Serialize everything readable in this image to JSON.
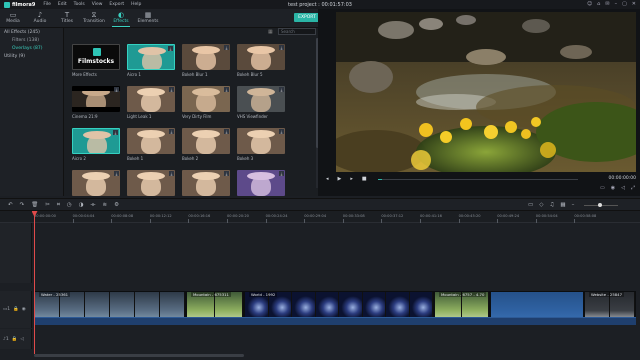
{
  "app": {
    "name": "filmora9",
    "menus": [
      "File",
      "Edit",
      "Tools",
      "View",
      "Export",
      "Help"
    ],
    "project_title": "test project : 00:01:57:03"
  },
  "toolbar": {
    "tabs": [
      {
        "label": "Media",
        "icon": "folder-icon"
      },
      {
        "label": "Audio",
        "icon": "music-note-icon"
      },
      {
        "label": "Titles",
        "icon": "text-t-icon"
      },
      {
        "label": "Transition",
        "icon": "transition-icon"
      },
      {
        "label": "Effects",
        "icon": "effects-icon",
        "active": true
      },
      {
        "label": "Elements",
        "icon": "elements-icon"
      }
    ],
    "export_label": "EXPORT"
  },
  "categories": [
    {
      "label": "All Effects (245)",
      "level": 0
    },
    {
      "label": "Filters (138)",
      "level": 1
    },
    {
      "label": "Overlays (87)",
      "level": 1,
      "selected": true
    },
    {
      "label": "Utility (9)",
      "level": 0
    }
  ],
  "effects_panel": {
    "search_placeholder": "Search",
    "items": [
      {
        "label": "More Effects",
        "style": "filmstocks",
        "badge": "Filmstocks"
      },
      {
        "label": "Aicro 1",
        "style": "teal"
      },
      {
        "label": "Bokeh Blur 1",
        "style": "warm"
      },
      {
        "label": "Bokeh Blur 5",
        "style": "warm"
      },
      {
        "label": "Cinema 21:9",
        "style": "cinema"
      },
      {
        "label": "Light Leak 1",
        "style": "light"
      },
      {
        "label": "Very Dirty Film",
        "style": "dirty"
      },
      {
        "label": "VHS Viewfinder",
        "style": "vhs"
      },
      {
        "label": "Aicro 2",
        "style": "teal"
      },
      {
        "label": "Bokeh 1",
        "style": "light"
      },
      {
        "label": "Bokeh 2",
        "style": "light"
      },
      {
        "label": "Bokeh 3",
        "style": "light"
      },
      {
        "label": "",
        "style": "light"
      },
      {
        "label": "",
        "style": "light"
      },
      {
        "label": "",
        "style": "light"
      },
      {
        "label": "",
        "style": "purple"
      }
    ]
  },
  "preview": {
    "timecode": "00:00:00:00",
    "progress": 0.02
  },
  "timeline": {
    "ruler": [
      "00:00:00:00",
      "00:00:04:04",
      "00:00:08:08",
      "00:00:12:12",
      "00:00:16:16",
      "00:00:20:20",
      "00:00:24:24",
      "00:00:29:04",
      "00:00:33:08",
      "00:00:37:12",
      "00:00:41:16",
      "00:00:45:20",
      "00:00:49:24",
      "00:00:54:04",
      "00:00:58:08"
    ],
    "clips": [
      {
        "name": "Water - 25361",
        "style": "water"
      },
      {
        "name": "Mountain - 675311",
        "style": "mountain"
      },
      {
        "name": "World - 1992",
        "style": "earth"
      },
      {
        "name": "Mountain - 6757 - 4.70",
        "style": "mountain"
      },
      {
        "name": "",
        "style": "blue"
      },
      {
        "name": "Website - 25847",
        "style": "dark"
      }
    ]
  }
}
